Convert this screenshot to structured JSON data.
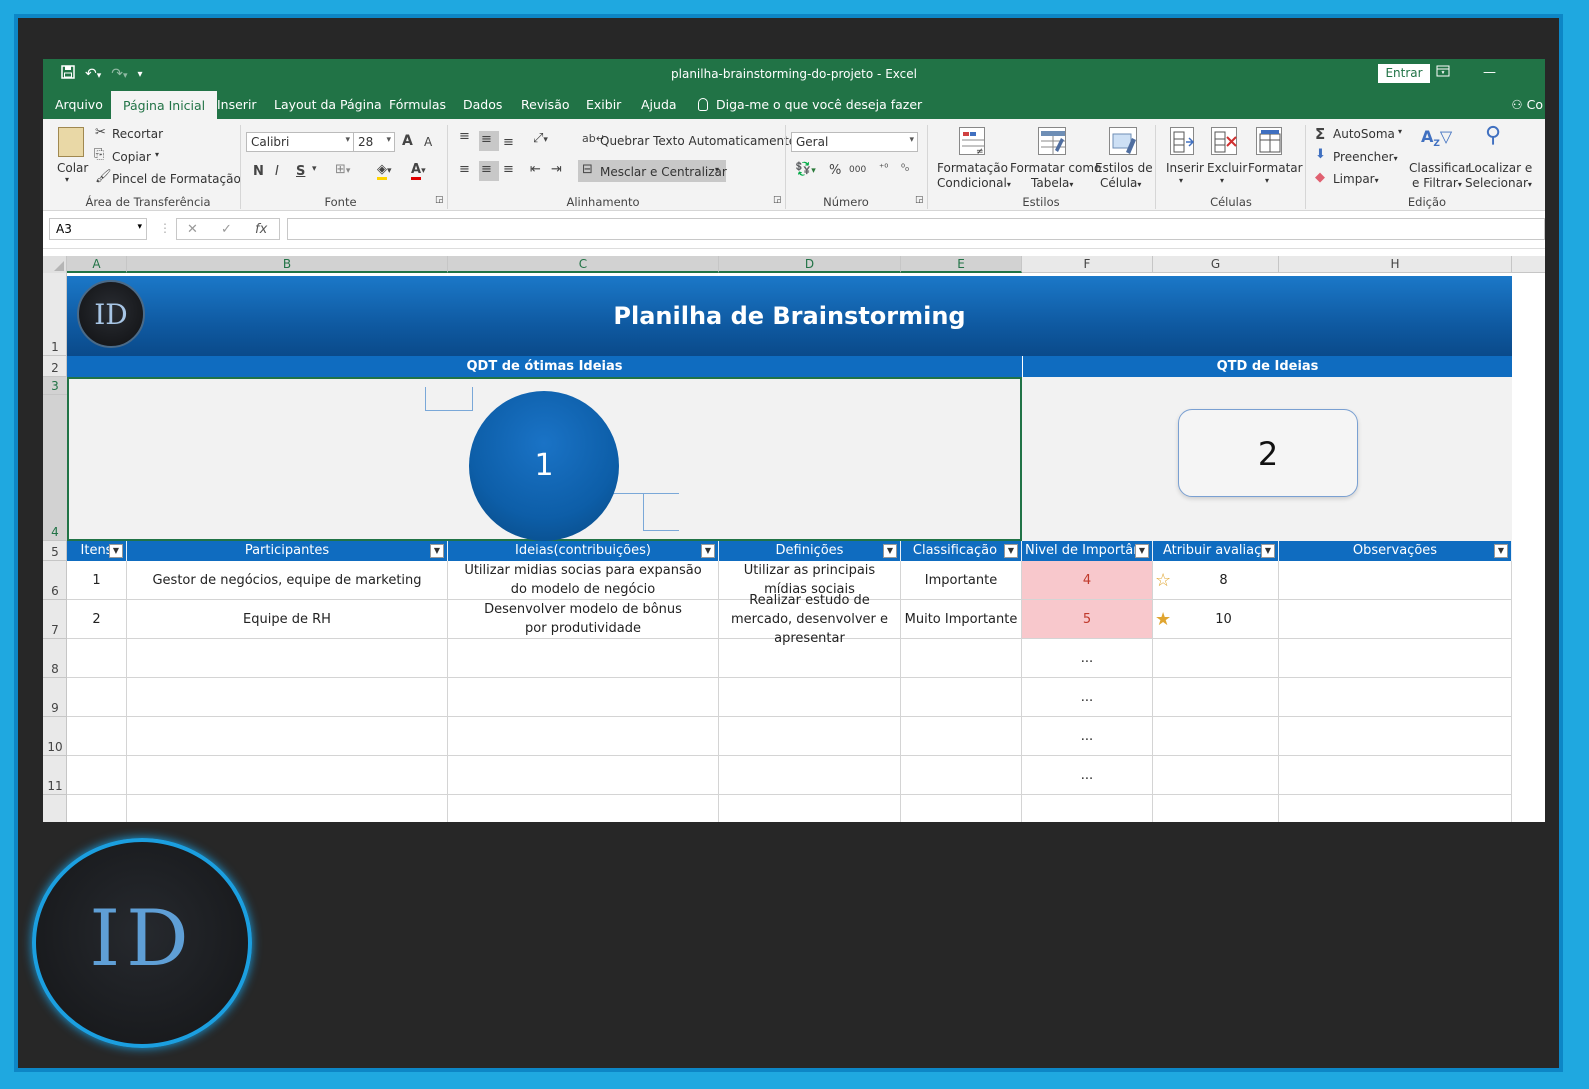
{
  "window": {
    "title": "planilha-brainstorming-do-projeto  -  Excel",
    "signin_label": "Entrar",
    "restore_icon": "ribbon-display-icon",
    "minimize_icon": "minimize-icon"
  },
  "quick_access": {
    "save_icon": "save-icon",
    "undo_icon": "undo-icon",
    "redo_icon": "redo-icon",
    "customize_icon": "customize-icon"
  },
  "tabs": [
    "Arquivo",
    "Página Inicial",
    "Inserir",
    "Layout da Página",
    "Fórmulas",
    "Dados",
    "Revisão",
    "Exibir",
    "Ajuda"
  ],
  "active_tab": "Página Inicial",
  "tell_me": "Diga-me o que você deseja fazer",
  "user_label": "Co",
  "ribbon": {
    "clipboard": {
      "paste": "Colar",
      "cut": "Recortar",
      "copy": "Copiar",
      "format_painter": "Pincel de Formatação",
      "group": "Área de Transferência"
    },
    "font": {
      "name": "Calibri",
      "size": "28",
      "bold": "N",
      "italic": "I",
      "underline": "S",
      "grow": "A",
      "shrink": "A",
      "font_color": "A",
      "group": "Fonte"
    },
    "alignment": {
      "wrap": "Quebrar Texto Automaticamente",
      "merge": "Mesclar e Centralizar",
      "group": "Alinhamento"
    },
    "number": {
      "format": "Geral",
      "percent": "%",
      "thousands": "000",
      "group": "Número"
    },
    "styles": {
      "conditional_1": "Formatação",
      "conditional_2": "Condicional",
      "table_1": "Formatar como",
      "table_2": "Tabela",
      "cell_1": "Estilos de",
      "cell_2": "Célula",
      "group": "Estilos"
    },
    "cells": {
      "insert": "Inserir",
      "delete": "Excluir",
      "format": "Formatar",
      "group": "Células"
    },
    "editing": {
      "autosum": "AutoSoma",
      "fill": "Preencher",
      "clear": "Limpar",
      "sort_1": "Classificar",
      "sort_2": "e Filtrar",
      "find_1": "Localizar e",
      "find_2": "Selecionar",
      "group": "Edição"
    }
  },
  "formula_bar": {
    "name_box": "A3",
    "cancel": "✕",
    "enter": "✓",
    "fx": "fx",
    "value": ""
  },
  "columns": [
    "A",
    "B",
    "C",
    "D",
    "E",
    "F",
    "G",
    "H"
  ],
  "rows": [
    "1",
    "2",
    "3",
    "4",
    "5",
    "6",
    "7",
    "8",
    "9",
    "10",
    "11"
  ],
  "sheet": {
    "logo_text": "ID",
    "title": "Planilha de Brainstorming",
    "kpi_left_label": "QDT de ótimas Ideias",
    "kpi_left_value": "1",
    "kpi_right_label": "QTD de Ideias",
    "kpi_right_value": "2"
  },
  "table": {
    "headers": [
      "Itens",
      "Participantes",
      "Ideias(contribuições)",
      "Definições",
      "Classificação",
      "Nivel de Importânc",
      "Atribuir avaliaçã",
      "Observações"
    ],
    "rows": [
      {
        "item": "1",
        "participantes": "Gestor de negócios, equipe de marketing",
        "ideias": "Utilizar midias socias para expansão do modelo de negócio",
        "definicoes": "Utilizar as principais mídias sociais",
        "classificacao": "Importante",
        "nivel": "4",
        "avaliacao": "8",
        "observacoes": ""
      },
      {
        "item": "2",
        "participantes": "Equipe de RH",
        "ideias": "Desenvolver modelo de bônus por produtividade",
        "definicoes": "Realizar estudo de mercado, desenvolver e apresentar",
        "classificacao": "Muito Importante",
        "nivel": "5",
        "avaliacao": "10",
        "observacoes": ""
      }
    ],
    "ellipsis": [
      "...",
      "...",
      "...",
      "..."
    ]
  },
  "brand_logo_text": "ID",
  "colors": {
    "excel_green": "#217346",
    "header_blue": "#0f6cc0",
    "frame_blue": "#1fa8e0",
    "pink_cell": "#f8c8cc"
  }
}
